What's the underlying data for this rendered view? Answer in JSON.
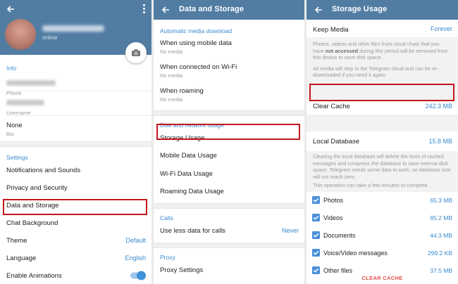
{
  "panel_profile": {
    "status": "online",
    "info_section_title": "Info",
    "phone_label": "Phone",
    "username_label": "Username",
    "bio_value": "None",
    "bio_label": "Bio",
    "settings_section_title": "Settings",
    "items": {
      "notifications": "Notifications and Sounds",
      "privacy": "Privacy and Security",
      "data_storage": "Data and Storage",
      "chat_background": "Chat Background",
      "theme": "Theme",
      "theme_value": "Default",
      "language": "Language",
      "language_value": "English",
      "animations": "Enable Animations"
    },
    "animations_enabled": true
  },
  "panel_data_storage": {
    "title": "Data and Storage",
    "auto_download_title": "Automatic media download",
    "mobile_data": "When using mobile data",
    "mobile_data_sub": "No media",
    "wifi": "When connected on Wi-Fi",
    "wifi_sub": "No media",
    "roaming": "When roaming",
    "roaming_sub": "No media",
    "disk_network_title": "Disk and network usage",
    "storage_usage": "Storage Usage",
    "mobile_usage": "Mobile Data Usage",
    "wifi_usage": "Wi-Fi Data Usage",
    "roaming_usage": "Roaming Data Usage",
    "calls_title": "Calls",
    "less_data_calls": "Use less data for calls",
    "less_data_calls_value": "Never",
    "proxy_title": "Proxy",
    "proxy_settings": "Proxy Settings"
  },
  "panel_storage_usage": {
    "title": "Storage Usage",
    "keep_media": "Keep Media",
    "keep_media_value": "Forever",
    "keep_info_1a": "Photos, videos and other files from cloud chats that you have ",
    "keep_info_1b": "not accessed",
    "keep_info_1c": " during this period will be removed from this device to save disk space.",
    "keep_info_2": "All media will stay in the Telegram cloud and can be re-downloaded if you need it again.",
    "clear_cache": "Clear Cache",
    "clear_cache_value": "242.3 MB",
    "local_db": "Local Database",
    "local_db_value": "15.8 MB",
    "db_info_1": "Clearing the local database will delete the texts of cached messages and compress the database to save internal disk space. Telegram needs some data to work, so database size will not reach zero.",
    "db_info_2": "This operation can take a few minutes to complete.",
    "files": [
      {
        "label": "Photos",
        "size": "65.3 MB"
      },
      {
        "label": "Videos",
        "size": "95.2 MB"
      },
      {
        "label": "Documents",
        "size": "44.3 MB"
      },
      {
        "label": "Voice/Video messages",
        "size": "299.2 KB"
      },
      {
        "label": "Other files",
        "size": "37.5 MB"
      }
    ],
    "clear_cache_button": "CLEAR CACHE"
  },
  "colors": {
    "header": "#527da3",
    "accent": "#3a8ad0",
    "highlight_box": "#c4161c",
    "danger_text": "#e0504a"
  }
}
